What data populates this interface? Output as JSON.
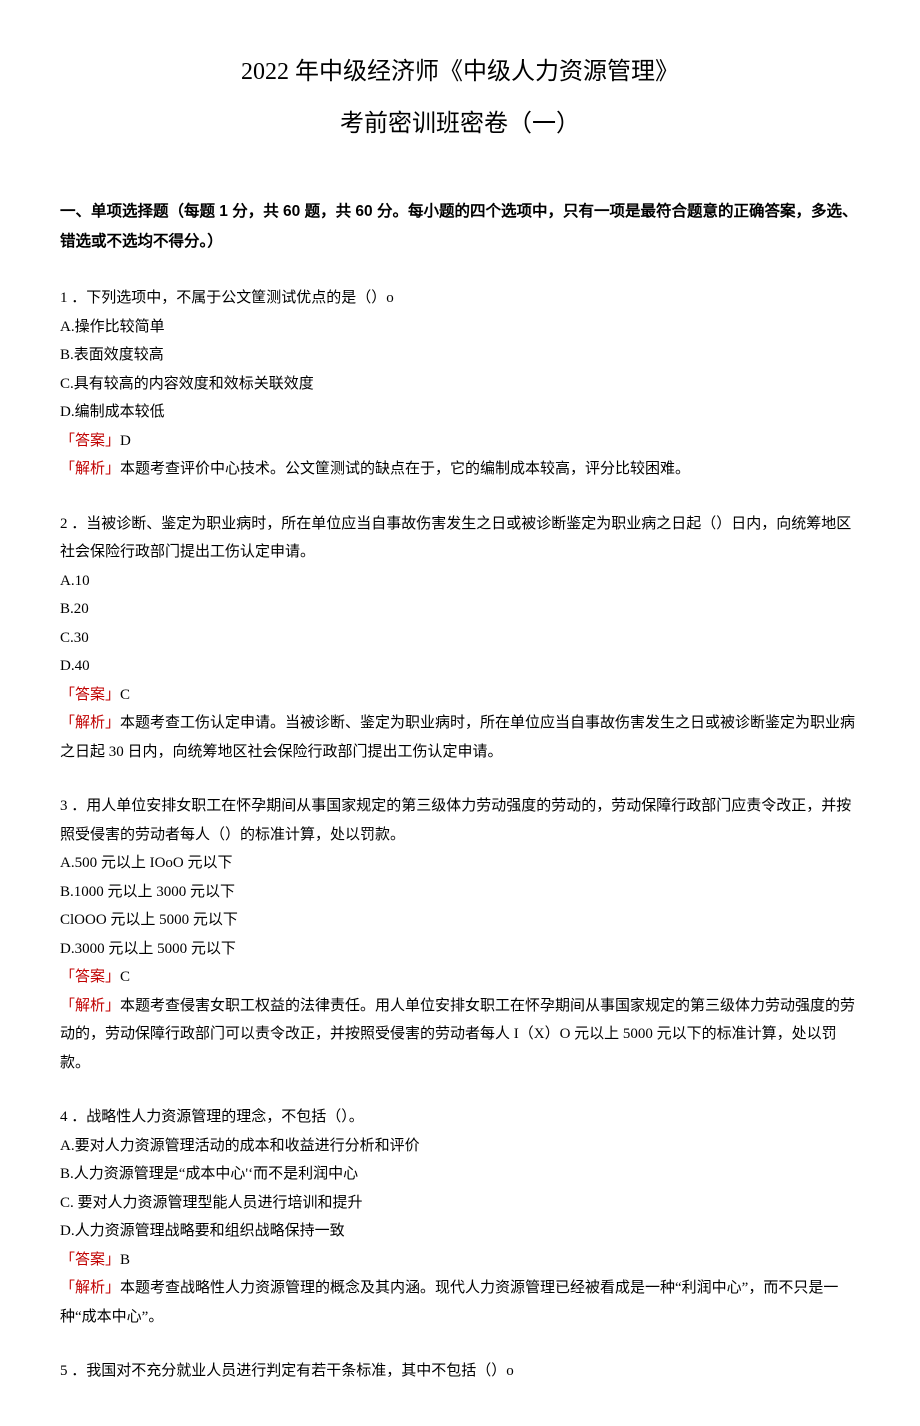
{
  "title_line1": "2022 年中级经济师《中级人力资源管理》",
  "title_line2": "考前密训班密卷（一）",
  "section_heading": "一、单项选择题（每题 1 分，共 60 题，共 60 分。每小题的四个选项中，只有一项是最符合题意的正确答案，多选、错选或不选均不得分。）",
  "answer_label_open": "「答案」",
  "explain_label_open": "「解析」",
  "q1": {
    "stem": "1 ．下列选项中，不属于公文筐测试优点的是（）o",
    "A": "A.操作比较简单",
    "B": "B.表面效度较高",
    "C": "C.具有较高的内容效度和效标关联效度",
    "D": "D.编制成本较低",
    "ans": "D",
    "exp": "本题考查评价中心技术。公文筐测试的缺点在于，它的编制成本较高，评分比较困难。"
  },
  "q2": {
    "stem": "2 ．当被诊断、鉴定为职业病时，所在单位应当自事故伤害发生之日或被诊断鉴定为职业病之日起（）日内，向统筹地区社会保险行政部门提出工伤认定申请。",
    "A": "A.10",
    "B": "B.20",
    "C": "C.30",
    "D": "D.40",
    "ans": "C",
    "exp": "本题考查工伤认定申请。当被诊断、鉴定为职业病时，所在单位应当自事故伤害发生之日或被诊断鉴定为职业病之日起 30 日内，向统筹地区社会保险行政部门提出工伤认定申请。"
  },
  "q3": {
    "stem": "3 ．用人单位安排女职工在怀孕期间从事国家规定的第三级体力劳动强度的劳动的，劳动保障行政部门应责令改正，并按照受侵害的劳动者每人（）的标准计算，处以罚款。",
    "A": "A.500 元以上 IOoO 元以下",
    "B": "B.1000 元以上 3000 元以下",
    "C": "ClOOO 元以上 5000 元以下",
    "D": "D.3000 元以上 5000 元以下",
    "ans": "C",
    "exp": "本题考查侵害女职工权益的法律责任。用人单位安排女职工在怀孕期间从事国家规定的第三级体力劳动强度的劳动的，劳动保障行政部门可以责令改正，并按照受侵害的劳动者每人 I（X）O 元以上 5000 元以下的标准计算，处以罚款。"
  },
  "q4": {
    "stem": "4 ．战略性人力资源管理的理念，不包括（）。",
    "A": "A.要对人力资源管理活动的成本和收益进行分析和评价",
    "B": "B.人力资源管理是“成本中心'‘而不是利润中心",
    "C": "C. 要对人力资源管理型能人员进行培训和提升",
    "D": "D.人力资源管理战略要和组织战略保持一致",
    "ans": "B",
    "exp": "本题考查战略性人力资源管理的概念及其内涵。现代人力资源管理已经被看成是一种“利润中心”，而不只是一种“成本中心”。"
  },
  "q5": {
    "stem": "5 ．我国对不充分就业人员进行判定有若干条标准，其中不包括（）o"
  }
}
